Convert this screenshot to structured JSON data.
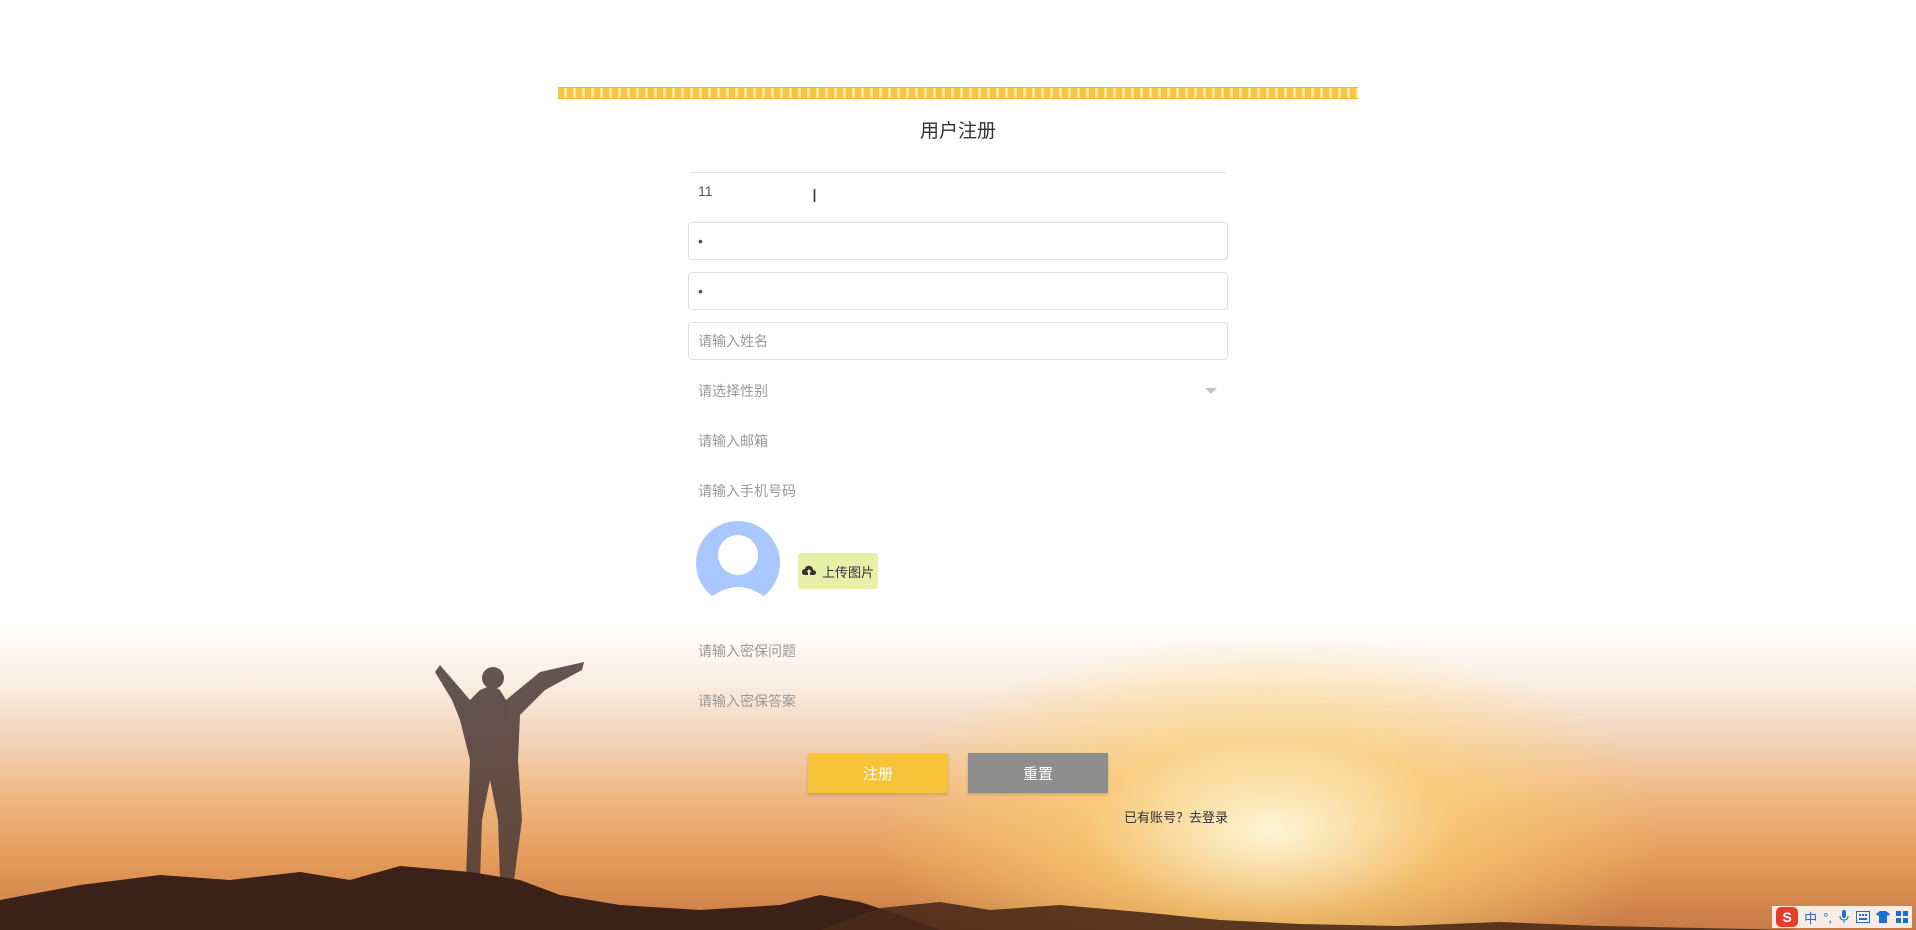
{
  "form": {
    "title": "用户注册",
    "username": {
      "value": "11"
    },
    "password": {
      "value": "•"
    },
    "confirm_password": {
      "value": "•"
    },
    "name": {
      "placeholder": "请输入姓名"
    },
    "gender": {
      "placeholder": "请选择性别"
    },
    "email": {
      "placeholder": "请输入邮箱"
    },
    "phone": {
      "placeholder": "请输入手机号码"
    },
    "upload_label": "上传图片",
    "security_question": {
      "placeholder": "请输入密保问题"
    },
    "security_answer": {
      "placeholder": "请输入密保答案"
    },
    "register_label": "注册",
    "reset_label": "重置",
    "login_link": "已有账号？去登录"
  },
  "ime": {
    "mode": "中",
    "punct": "°,"
  },
  "colors": {
    "accent": "#f6c33a",
    "reset": "#8e8e8e",
    "upload": "#e7f0a8",
    "avatar": "#a9c8ff"
  }
}
